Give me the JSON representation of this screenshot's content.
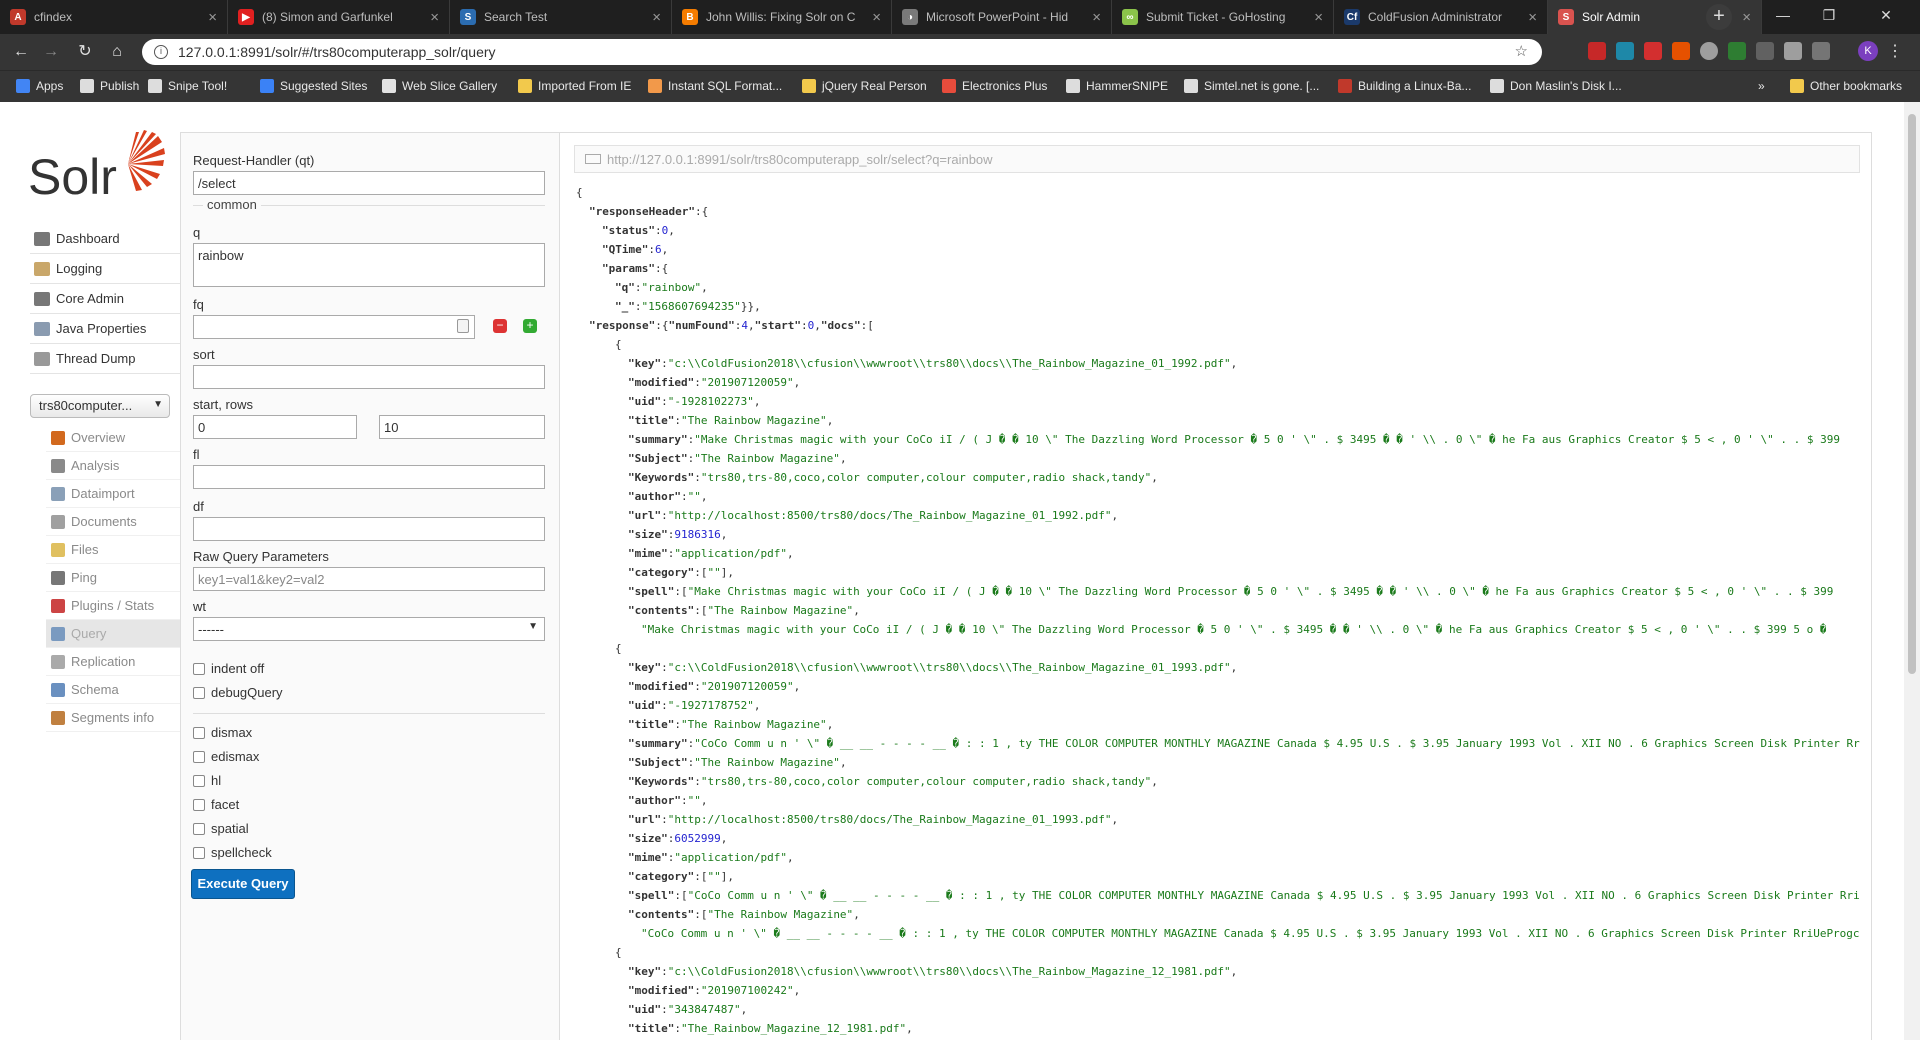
{
  "browser": {
    "tabs": [
      {
        "title": "cfindex",
        "color": "#c0392b",
        "glyph": "A"
      },
      {
        "title": "(8) Simon and Garfunkel",
        "color": "#e02020",
        "glyph": "▶"
      },
      {
        "title": "Search Test",
        "color": "#2b6cb0",
        "glyph": "S"
      },
      {
        "title": "John Willis: Fixing Solr on C",
        "color": "#f57c00",
        "glyph": "B"
      },
      {
        "title": "Microsoft PowerPoint - Hid",
        "color": "#7a7a7a",
        "glyph": "◑"
      },
      {
        "title": "Submit Ticket - GoHosting",
        "color": "#8bc34a",
        "glyph": "∞"
      },
      {
        "title": "ColdFusion Administrator",
        "color": "#1b3a6b",
        "glyph": "Cf"
      },
      {
        "title": "Solr Admin",
        "color": "#d9534f",
        "glyph": "S"
      }
    ],
    "new_tab": "+",
    "window_controls": [
      "—",
      "❐",
      "✕"
    ],
    "address": "127.0.0.1:8991/solr/#/trs80computerapp_solr/query",
    "avatar_letter": "K",
    "bookmarks": [
      {
        "label": "Apps",
        "color": "#4285f4"
      },
      {
        "label": "Publish",
        "color": "#dddddd"
      },
      {
        "label": "Snipe Tool!",
        "color": "#dddddd"
      },
      {
        "label": "Suggested Sites",
        "color": "#3b82f6"
      },
      {
        "label": "Web Slice Gallery",
        "color": "#e2e2e2"
      },
      {
        "label": "Imported From IE",
        "color": "#f2c94c"
      },
      {
        "label": "Instant SQL Format...",
        "color": "#f2994a"
      },
      {
        "label": "jQuery Real Person",
        "color": "#f2c94c"
      },
      {
        "label": "Electronics Plus",
        "color": "#e74c3c"
      },
      {
        "label": "HammerSNIPE",
        "color": "#dddddd"
      },
      {
        "label": "Simtel.net is gone. [...",
        "color": "#dddddd"
      },
      {
        "label": "Building a Linux-Ba...",
        "color": "#c0392b"
      },
      {
        "label": "Don Maslin's Disk I...",
        "color": "#dddddd"
      }
    ],
    "bookmarks_more": "»",
    "other_bookmarks": "Other bookmarks"
  },
  "solr": {
    "logo_text": "Solr",
    "nav": [
      {
        "label": "Dashboard"
      },
      {
        "label": "Logging"
      },
      {
        "label": "Core Admin"
      },
      {
        "label": "Java Properties"
      },
      {
        "label": "Thread Dump"
      }
    ],
    "core_selected": "trs80computer...",
    "core_menu": [
      {
        "label": "Overview"
      },
      {
        "label": "Analysis"
      },
      {
        "label": "Dataimport"
      },
      {
        "label": "Documents"
      },
      {
        "label": "Files"
      },
      {
        "label": "Ping"
      },
      {
        "label": "Plugins / Stats"
      },
      {
        "label": "Query",
        "selected": true
      },
      {
        "label": "Replication"
      },
      {
        "label": "Schema"
      },
      {
        "label": "Segments info"
      }
    ]
  },
  "form": {
    "qt_label": "Request-Handler (qt)",
    "qt_value": "/select",
    "common_legend": "common",
    "q_label": "q",
    "q_value": "rainbow",
    "fq_label": "fq",
    "fq_value": "",
    "sort_label": "sort",
    "sort_value": "",
    "start_rows_label": "start, rows",
    "start_value": "0",
    "rows_value": "10",
    "fl_label": "fl",
    "fl_value": "",
    "df_label": "df",
    "df_value": "",
    "raw_label": "Raw Query Parameters",
    "raw_placeholder": "key1=val1&key2=val2",
    "wt_label": "wt",
    "wt_value": "------",
    "checkboxes_top": [
      "indent off",
      "debugQuery"
    ],
    "checkboxes_bottom": [
      "dismax",
      "edismax",
      "hl",
      "facet",
      "spatial",
      "spellcheck"
    ],
    "execute_label": "Execute Query"
  },
  "result": {
    "request_url": "http://127.0.0.1:8991/solr/trs80computerapp_solr/select?q=rainbow",
    "lines": [
      {
        "indent": 0,
        "parts": [
          [
            "p",
            "{"
          ]
        ]
      },
      {
        "indent": 1,
        "parts": [
          [
            "k",
            "\"responseHeader\""
          ],
          [
            "p",
            ":{"
          ]
        ]
      },
      {
        "indent": 2,
        "parts": [
          [
            "k",
            "\"status\""
          ],
          [
            "p",
            ":"
          ],
          [
            "n",
            "0"
          ],
          [
            "p",
            ","
          ]
        ]
      },
      {
        "indent": 2,
        "parts": [
          [
            "k",
            "\"QTime\""
          ],
          [
            "p",
            ":"
          ],
          [
            "n",
            "6"
          ],
          [
            "p",
            ","
          ]
        ]
      },
      {
        "indent": 2,
        "parts": [
          [
            "k",
            "\"params\""
          ],
          [
            "p",
            ":{"
          ]
        ]
      },
      {
        "indent": 3,
        "parts": [
          [
            "k",
            "\"q\""
          ],
          [
            "p",
            ":"
          ],
          [
            "s",
            "\"rainbow\""
          ],
          [
            "p",
            ","
          ]
        ]
      },
      {
        "indent": 3,
        "parts": [
          [
            "k",
            "\"_\""
          ],
          [
            "p",
            ":"
          ],
          [
            "s",
            "\"1568607694235\""
          ],
          [
            "p",
            "}},"
          ]
        ]
      },
      {
        "indent": 1,
        "parts": [
          [
            "k",
            "\"response\""
          ],
          [
            "p",
            ":{"
          ],
          [
            "k",
            "\"numFound\""
          ],
          [
            "p",
            ":"
          ],
          [
            "n",
            "4"
          ],
          [
            "p",
            ","
          ],
          [
            "k",
            "\"start\""
          ],
          [
            "p",
            ":"
          ],
          [
            "n",
            "0"
          ],
          [
            "p",
            ","
          ],
          [
            "k",
            "\"docs\""
          ],
          [
            "p",
            ":["
          ]
        ]
      },
      {
        "indent": 3,
        "parts": [
          [
            "p",
            "{"
          ]
        ]
      },
      {
        "indent": 4,
        "parts": [
          [
            "k",
            "\"key\""
          ],
          [
            "p",
            ":"
          ],
          [
            "s",
            "\"c:\\\\ColdFusion2018\\\\cfusion\\\\wwwroot\\\\trs80\\\\docs\\\\The_Rainbow_Magazine_01_1992.pdf\""
          ],
          [
            "p",
            ","
          ]
        ]
      },
      {
        "indent": 4,
        "parts": [
          [
            "k",
            "\"modified\""
          ],
          [
            "p",
            ":"
          ],
          [
            "s",
            "\"201907120059\""
          ],
          [
            "p",
            ","
          ]
        ]
      },
      {
        "indent": 4,
        "parts": [
          [
            "k",
            "\"uid\""
          ],
          [
            "p",
            ":"
          ],
          [
            "s",
            "\"-1928102273\""
          ],
          [
            "p",
            ","
          ]
        ]
      },
      {
        "indent": 4,
        "parts": [
          [
            "k",
            "\"title\""
          ],
          [
            "p",
            ":"
          ],
          [
            "s",
            "\"The Rainbow Magazine\""
          ],
          [
            "p",
            ","
          ]
        ]
      },
      {
        "indent": 4,
        "parts": [
          [
            "k",
            "\"summary\""
          ],
          [
            "p",
            ":"
          ],
          [
            "s",
            "\"Make Christmas magic with your CoCo iI / ( J � � 10 \\\" The Dazzling Word Processor � 5 0 ' \\\" . $ 3495 � � ' \\\\ . 0 \\\" � he Fa aus Graphics Creator $ 5 < , 0 ' \\\" . . $ 399"
          ]
        ]
      },
      {
        "indent": 4,
        "parts": [
          [
            "k",
            "\"Subject\""
          ],
          [
            "p",
            ":"
          ],
          [
            "s",
            "\"The Rainbow Magazine\""
          ],
          [
            "p",
            ","
          ]
        ]
      },
      {
        "indent": 4,
        "parts": [
          [
            "k",
            "\"Keywords\""
          ],
          [
            "p",
            ":"
          ],
          [
            "s",
            "\"trs80,trs-80,coco,color computer,colour computer,radio shack,tandy\""
          ],
          [
            "p",
            ","
          ]
        ]
      },
      {
        "indent": 4,
        "parts": [
          [
            "k",
            "\"author\""
          ],
          [
            "p",
            ":"
          ],
          [
            "s",
            "\"\""
          ],
          [
            "p",
            ","
          ]
        ]
      },
      {
        "indent": 4,
        "parts": [
          [
            "k",
            "\"url\""
          ],
          [
            "p",
            ":"
          ],
          [
            "s",
            "\"http://localhost:8500/trs80/docs/The_Rainbow_Magazine_01_1992.pdf\""
          ],
          [
            "p",
            ","
          ]
        ]
      },
      {
        "indent": 4,
        "parts": [
          [
            "k",
            "\"size\""
          ],
          [
            "p",
            ":"
          ],
          [
            "n",
            "9186316"
          ],
          [
            "p",
            ","
          ]
        ]
      },
      {
        "indent": 4,
        "parts": [
          [
            "k",
            "\"mime\""
          ],
          [
            "p",
            ":"
          ],
          [
            "s",
            "\"application/pdf\""
          ],
          [
            "p",
            ","
          ]
        ]
      },
      {
        "indent": 4,
        "parts": [
          [
            "k",
            "\"category\""
          ],
          [
            "p",
            ":["
          ],
          [
            "s",
            "\"\""
          ],
          [
            "p",
            "],"
          ]
        ]
      },
      {
        "indent": 4,
        "parts": [
          [
            "k",
            "\"spell\""
          ],
          [
            "p",
            ":["
          ],
          [
            "s",
            "\"Make Christmas magic with your CoCo iI / ( J � � 10 \\\" The Dazzling Word Processor � 5 0 ' \\\" . $ 3495 � � ' \\\\ . 0 \\\" � he Fa aus Graphics Creator $ 5 < , 0 ' \\\" . . $ 399"
          ]
        ]
      },
      {
        "indent": 4,
        "parts": [
          [
            "k",
            "\"contents\""
          ],
          [
            "p",
            ":["
          ],
          [
            "s",
            "\"The Rainbow Magazine\""
          ],
          [
            "p",
            ","
          ]
        ]
      },
      {
        "indent": 5,
        "parts": [
          [
            "s",
            "\"Make Christmas magic with your CoCo iI / ( J � � 10 \\\" The Dazzling Word Processor � 5 0 ' \\\" . $ 3495 � � ' \\\\ . 0 \\\" � he Fa aus Graphics Creator $ 5 < , 0 ' \\\" . . $ 399 5 o �"
          ]
        ]
      },
      {
        "indent": 3,
        "parts": [
          [
            "p",
            "{"
          ]
        ]
      },
      {
        "indent": 4,
        "parts": [
          [
            "k",
            "\"key\""
          ],
          [
            "p",
            ":"
          ],
          [
            "s",
            "\"c:\\\\ColdFusion2018\\\\cfusion\\\\wwwroot\\\\trs80\\\\docs\\\\The_Rainbow_Magazine_01_1993.pdf\""
          ],
          [
            "p",
            ","
          ]
        ]
      },
      {
        "indent": 4,
        "parts": [
          [
            "k",
            "\"modified\""
          ],
          [
            "p",
            ":"
          ],
          [
            "s",
            "\"201907120059\""
          ],
          [
            "p",
            ","
          ]
        ]
      },
      {
        "indent": 4,
        "parts": [
          [
            "k",
            "\"uid\""
          ],
          [
            "p",
            ":"
          ],
          [
            "s",
            "\"-1927178752\""
          ],
          [
            "p",
            ","
          ]
        ]
      },
      {
        "indent": 4,
        "parts": [
          [
            "k",
            "\"title\""
          ],
          [
            "p",
            ":"
          ],
          [
            "s",
            "\"The Rainbow Magazine\""
          ],
          [
            "p",
            ","
          ]
        ]
      },
      {
        "indent": 4,
        "parts": [
          [
            "k",
            "\"summary\""
          ],
          [
            "p",
            ":"
          ],
          [
            "s",
            "\"CoCo Comm u n ' \\\" � __ __ - - - - __ � : : 1 , ty THE COLOR COMPUTER MONTHLY MAGAZINE Canada $ 4.95 U.S . $ 3.95 January 1993 Vol . XII NO . 6 Graphics Screen Disk Printer Rr"
          ]
        ]
      },
      {
        "indent": 4,
        "parts": [
          [
            "k",
            "\"Subject\""
          ],
          [
            "p",
            ":"
          ],
          [
            "s",
            "\"The Rainbow Magazine\""
          ],
          [
            "p",
            ","
          ]
        ]
      },
      {
        "indent": 4,
        "parts": [
          [
            "k",
            "\"Keywords\""
          ],
          [
            "p",
            ":"
          ],
          [
            "s",
            "\"trs80,trs-80,coco,color computer,colour computer,radio shack,tandy\""
          ],
          [
            "p",
            ","
          ]
        ]
      },
      {
        "indent": 4,
        "parts": [
          [
            "k",
            "\"author\""
          ],
          [
            "p",
            ":"
          ],
          [
            "s",
            "\"\""
          ],
          [
            "p",
            ","
          ]
        ]
      },
      {
        "indent": 4,
        "parts": [
          [
            "k",
            "\"url\""
          ],
          [
            "p",
            ":"
          ],
          [
            "s",
            "\"http://localhost:8500/trs80/docs/The_Rainbow_Magazine_01_1993.pdf\""
          ],
          [
            "p",
            ","
          ]
        ]
      },
      {
        "indent": 4,
        "parts": [
          [
            "k",
            "\"size\""
          ],
          [
            "p",
            ":"
          ],
          [
            "n",
            "6052999"
          ],
          [
            "p",
            ","
          ]
        ]
      },
      {
        "indent": 4,
        "parts": [
          [
            "k",
            "\"mime\""
          ],
          [
            "p",
            ":"
          ],
          [
            "s",
            "\"application/pdf\""
          ],
          [
            "p",
            ","
          ]
        ]
      },
      {
        "indent": 4,
        "parts": [
          [
            "k",
            "\"category\""
          ],
          [
            "p",
            ":["
          ],
          [
            "s",
            "\"\""
          ],
          [
            "p",
            "],"
          ]
        ]
      },
      {
        "indent": 4,
        "parts": [
          [
            "k",
            "\"spell\""
          ],
          [
            "p",
            ":["
          ],
          [
            "s",
            "\"CoCo Comm u n ' \\\" � __ __ - - - - __ � : : 1 , ty THE COLOR COMPUTER MONTHLY MAGAZINE Canada $ 4.95 U.S . $ 3.95 January 1993 Vol . XII NO . 6 Graphics Screen Disk Printer Rri"
          ]
        ]
      },
      {
        "indent": 4,
        "parts": [
          [
            "k",
            "\"contents\""
          ],
          [
            "p",
            ":["
          ],
          [
            "s",
            "\"The Rainbow Magazine\""
          ],
          [
            "p",
            ","
          ]
        ]
      },
      {
        "indent": 5,
        "parts": [
          [
            "s",
            "\"CoCo Comm u n ' \\\" � __ __ - - - - __ � : : 1 , ty THE COLOR COMPUTER MONTHLY MAGAZINE Canada $ 4.95 U.S . $ 3.95 January 1993 Vol . XII NO . 6 Graphics Screen Disk Printer RriUeProgc"
          ]
        ]
      },
      {
        "indent": 3,
        "parts": [
          [
            "p",
            "{"
          ]
        ]
      },
      {
        "indent": 4,
        "parts": [
          [
            "k",
            "\"key\""
          ],
          [
            "p",
            ":"
          ],
          [
            "s",
            "\"c:\\\\ColdFusion2018\\\\cfusion\\\\wwwroot\\\\trs80\\\\docs\\\\The_Rainbow_Magazine_12_1981.pdf\""
          ],
          [
            "p",
            ","
          ]
        ]
      },
      {
        "indent": 4,
        "parts": [
          [
            "k",
            "\"modified\""
          ],
          [
            "p",
            ":"
          ],
          [
            "s",
            "\"201907100242\""
          ],
          [
            "p",
            ","
          ]
        ]
      },
      {
        "indent": 4,
        "parts": [
          [
            "k",
            "\"uid\""
          ],
          [
            "p",
            ":"
          ],
          [
            "s",
            "\"343847487\""
          ],
          [
            "p",
            ","
          ]
        ]
      },
      {
        "indent": 4,
        "parts": [
          [
            "k",
            "\"title\""
          ],
          [
            "p",
            ":"
          ],
          [
            "s",
            "\"The_Rainbow_Magazine_12_1981.pdf\""
          ],
          [
            "p",
            ","
          ]
        ]
      }
    ]
  }
}
